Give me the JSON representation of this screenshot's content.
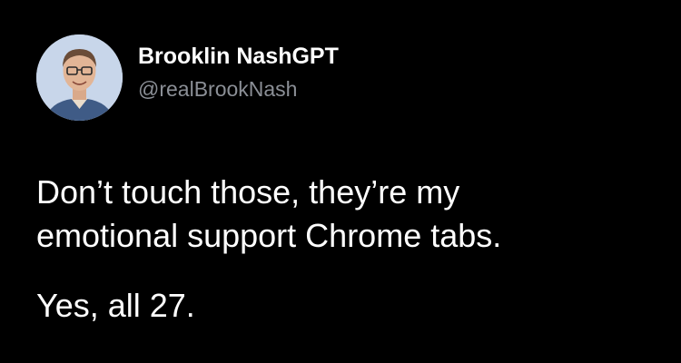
{
  "tweet": {
    "author": {
      "display_name": "Brooklin NashGPT",
      "handle": "@realBrookNash"
    },
    "text_lines": [
      "Don’t touch those, they’re my",
      "emotional support Chrome tabs."
    ],
    "followup": "Yes, all 27."
  },
  "colors": {
    "background": "#000000",
    "text": "#ffffff",
    "handle": "#8b8f96"
  },
  "icons": {
    "avatar": "profile-photo"
  }
}
